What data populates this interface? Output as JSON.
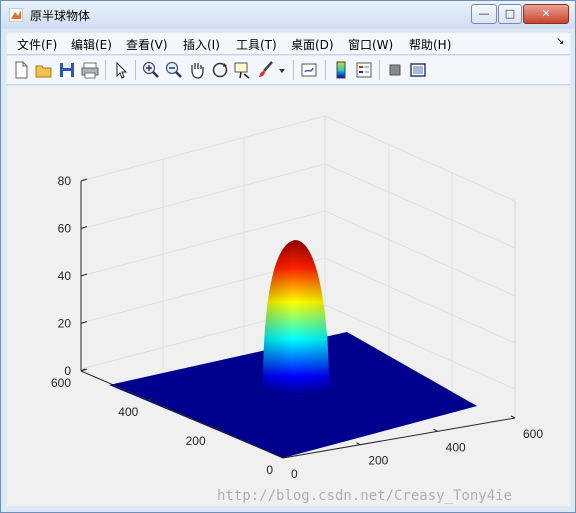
{
  "window": {
    "title": "原半球物体",
    "minimize": "—",
    "maximize": "□",
    "close": "✕"
  },
  "menu": {
    "items": [
      "文件(F)",
      "编辑(E)",
      "查看(V)",
      "插入(I)",
      "工具(T)",
      "桌面(D)",
      "窗口(W)",
      "帮助(H)"
    ],
    "dock_arrow": "↘"
  },
  "toolbar": {
    "icons": [
      "new-figure-icon",
      "open-icon",
      "save-icon",
      "print-icon",
      "pointer-icon",
      "zoom-in-icon",
      "zoom-out-icon",
      "pan-hand-icon",
      "rotate-3d-icon",
      "data-cursor-icon",
      "brush-icon",
      "link-plot-icon",
      "colorbar-icon",
      "legend-icon",
      "hide-plot-tools-icon",
      "show-plot-tools-icon"
    ]
  },
  "chart_data": {
    "type": "surface",
    "description_shape": "dome of height ~55 on flat plane at 0",
    "x": {
      "ticks": [
        "0",
        "200",
        "400",
        "600"
      ],
      "lim": [
        0,
        600
      ]
    },
    "y": {
      "ticks": [
        "0",
        "200",
        "400",
        "600"
      ],
      "lim": [
        0,
        600
      ]
    },
    "z": {
      "ticks": [
        "0",
        "20",
        "40",
        "60",
        "80"
      ],
      "lim": [
        0,
        80
      ]
    },
    "peak_z": 55,
    "colormap": "jet",
    "grid": true
  },
  "watermark": "http://blog.csdn.net/Creasy_Tony4ie",
  "colors": {
    "plane": "#00008f",
    "peak": "#8f0000",
    "axes_line": "#262626",
    "grid": "#e0e0e0"
  }
}
